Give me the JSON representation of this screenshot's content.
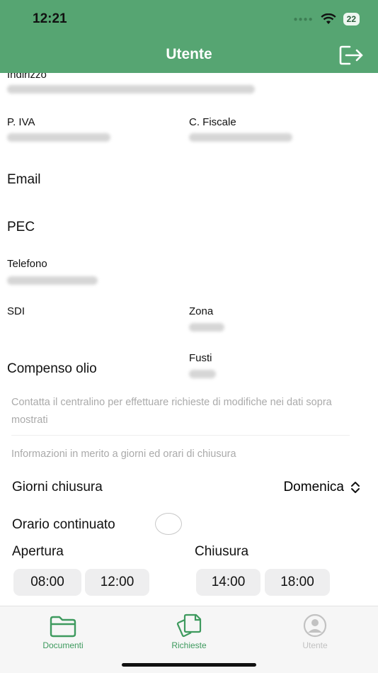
{
  "status_bar": {
    "time": "12:21",
    "battery": "22"
  },
  "header": {
    "title": "Utente",
    "logout_icon": "logout-icon"
  },
  "fields": {
    "indirizzo_label": "Indirizzo",
    "piva_label": "P. IVA",
    "cf_label": "C. Fiscale",
    "email_label": "Email",
    "pec_label": "PEC",
    "telefono_label": "Telefono",
    "sdi_label": "SDI",
    "zona_label": "Zona",
    "compenso_label": "Compenso olio",
    "fusti_label": "Fusti"
  },
  "notes": {
    "contact": "Contatta il centralino per effettuare richieste di modifiche nei dati sopra mostrati",
    "info": "Informazioni in merito a giorni ed orari di chiusura"
  },
  "closure": {
    "giorni_label": "Giorni chiusura",
    "giorni_value": "Domenica",
    "orario_label": "Orario continuato",
    "apertura_label": "Apertura",
    "chiusura_label": "Chiusura",
    "apertura_from": "08:00",
    "apertura_to": "12:00",
    "chiusura_from": "14:00",
    "chiusura_to": "18:00"
  },
  "tabs": [
    {
      "label": "Documenti",
      "icon": "folder-icon",
      "color": "#3e9a5e"
    },
    {
      "label": "Richieste",
      "icon": "documents-icon",
      "color": "#3e9a5e"
    },
    {
      "label": "Utente",
      "icon": "user-icon",
      "color": "#c2c2c2"
    }
  ],
  "colors": {
    "accent": "#56a572",
    "tab_active": "#3e9a5e",
    "tab_inactive": "#c2c2c2"
  }
}
